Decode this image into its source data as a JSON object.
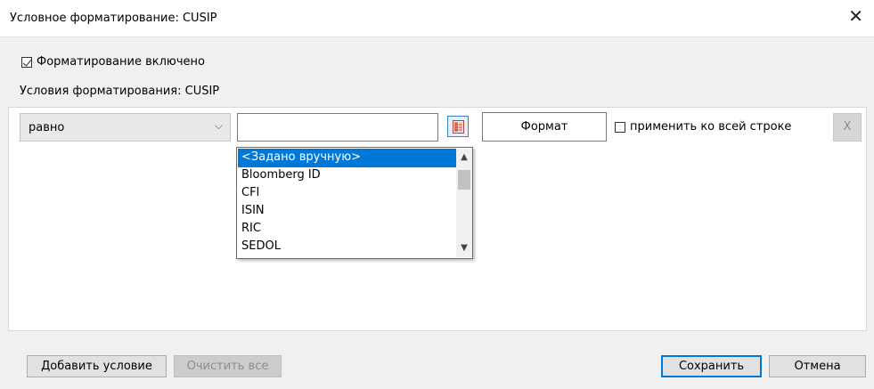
{
  "window": {
    "title": "Условное форматирование: CUSIP",
    "close_glyph": "✕"
  },
  "formatting_enabled": {
    "label": "Форматирование включено",
    "checked": true
  },
  "conditions_label": "Условия форматирования: CUSIP",
  "condition": {
    "operator": "равно",
    "value": "",
    "format_button": "Формат",
    "apply_row_label": "применить ко всей строке",
    "apply_row_checked": false,
    "remove_button": "X"
  },
  "dropdown": {
    "items": [
      "<Задано вручную>",
      "Bloomberg ID",
      "CFI",
      "ISIN",
      "RIC",
      "SEDOL"
    ],
    "selected_index": 0
  },
  "footer": {
    "add_condition": "Добавить условие",
    "clear_all": "Очистить все",
    "save": "Сохранить",
    "cancel": "Отмена"
  },
  "colors": {
    "selection": "#0078d7",
    "icon_accent": "#c0392b"
  }
}
